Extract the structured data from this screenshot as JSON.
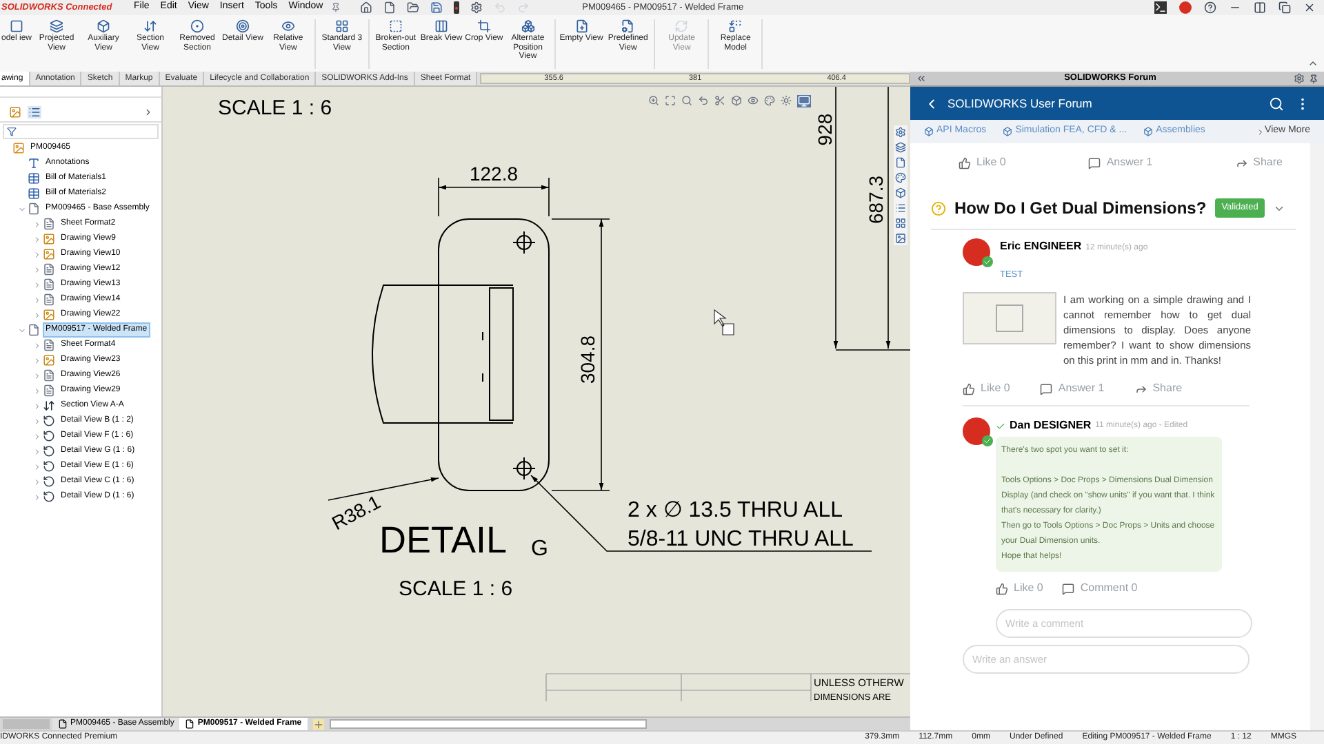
{
  "title_bar": {
    "brand": "SOLIDWORKS Connected",
    "menus": [
      "File",
      "Edit",
      "View",
      "Insert",
      "Tools",
      "Window"
    ],
    "title": "PM009465 - PM009517 - Welded Frame"
  },
  "ribbon": {
    "groups": [
      [
        {
          "label": "odel iew",
          "disabled": false
        },
        {
          "label": "Projected View",
          "disabled": false
        },
        {
          "label": "Auxiliary View",
          "disabled": false
        },
        {
          "label": "Section View",
          "disabled": false
        },
        {
          "label": "Removed Section",
          "disabled": false
        },
        {
          "label": "Detail View",
          "disabled": false
        },
        {
          "label": "Relative View",
          "disabled": false
        }
      ],
      [
        {
          "label": "Standard 3 View",
          "disabled": false
        }
      ],
      [
        {
          "label": "Broken-out Section",
          "disabled": false
        },
        {
          "label": "Break View",
          "disabled": false
        },
        {
          "label": "Crop View",
          "disabled": false
        },
        {
          "label": "Alternate Position View",
          "disabled": false
        }
      ],
      [
        {
          "label": "Empty View",
          "disabled": false
        },
        {
          "label": "Predefined View",
          "disabled": false
        }
      ],
      [
        {
          "label": "Update View",
          "disabled": true
        }
      ],
      [
        {
          "label": "Replace Model",
          "disabled": false
        }
      ]
    ]
  },
  "tabs": [
    {
      "label": "awing",
      "selected": true
    },
    {
      "label": "Annotation",
      "selected": false
    },
    {
      "label": "Sketch",
      "selected": false
    },
    {
      "label": "Markup",
      "selected": false
    },
    {
      "label": "Evaluate",
      "selected": false
    },
    {
      "label": "Lifecycle and Collaboration",
      "selected": false
    },
    {
      "label": "SOLIDWORKS Add-Ins",
      "selected": false
    },
    {
      "label": "Sheet Format",
      "selected": false
    }
  ],
  "ruler": [
    "355.6",
    "381",
    "406.4"
  ],
  "tree": [
    {
      "label": "PM009465",
      "kind": "drawing",
      "selected": false,
      "children": [
        {
          "label": "Annotations",
          "kind": "annotations",
          "selected": false
        },
        {
          "label": "Bill of Materials1",
          "kind": "bom",
          "selected": false
        },
        {
          "label": "Bill of Materials2",
          "kind": "bom",
          "selected": false
        },
        {
          "label": "PM009465 - Base Assembly",
          "kind": "sheet",
          "selected": false,
          "expanded": true,
          "children": [
            {
              "label": "Sheet Format2",
              "kind": "sheet-format",
              "selected": false,
              "expanded": false
            },
            {
              "label": "Drawing View9",
              "kind": "model-view",
              "selected": false,
              "expanded": false
            },
            {
              "label": "Drawing View10",
              "kind": "model-view",
              "selected": false,
              "expanded": false
            },
            {
              "label": "Drawing View12",
              "kind": "view",
              "selected": false,
              "expanded": false
            },
            {
              "label": "Drawing View13",
              "kind": "view",
              "selected": false,
              "expanded": false
            },
            {
              "label": "Drawing View14",
              "kind": "view",
              "selected": false,
              "expanded": false
            },
            {
              "label": "Drawing View22",
              "kind": "model-view",
              "selected": false,
              "expanded": false
            }
          ]
        },
        {
          "label": "PM009517 - Welded Frame",
          "kind": "sheet",
          "selected": true,
          "expanded": true,
          "children": [
            {
              "label": "Sheet Format4",
              "kind": "sheet-format",
              "selected": false,
              "expanded": false
            },
            {
              "label": "Drawing View23",
              "kind": "model-view",
              "selected": false,
              "expanded": false
            },
            {
              "label": "Drawing View26",
              "kind": "view",
              "selected": false,
              "expanded": false
            },
            {
              "label": "Drawing View29",
              "kind": "view",
              "selected": false,
              "expanded": false
            },
            {
              "label": "Section View A-A",
              "kind": "section",
              "selected": false,
              "expanded": false
            },
            {
              "label": "Detail View B (1 : 2)",
              "kind": "detail",
              "selected": false,
              "expanded": false
            },
            {
              "label": "Detail View F (1 : 6)",
              "kind": "detail",
              "selected": false,
              "expanded": false
            },
            {
              "label": "Detail View G (1 : 6)",
              "kind": "detail",
              "selected": false,
              "expanded": false
            },
            {
              "label": "Detail View E (1 : 6)",
              "kind": "detail",
              "selected": false,
              "expanded": false
            },
            {
              "label": "Detail View C (1 : 6)",
              "kind": "detail",
              "selected": false,
              "expanded": false
            },
            {
              "label": "Detail View D (1 : 6)",
              "kind": "detail",
              "selected": false,
              "expanded": false
            }
          ]
        }
      ]
    }
  ],
  "drawing": {
    "scale_top": "SCALE 1 : 6",
    "width_dim": "122.8",
    "height_dim": "304.8",
    "radius_dim": "R38.1",
    "side_dims": [
      "928",
      "687.3"
    ],
    "detail_label": "DETAIL",
    "detail_letter": "G",
    "detail_scale": "SCALE 1 : 6",
    "notes": [
      "2 x ∅ 13.5 THRU ALL",
      "5/8-11 UNC THRU ALL"
    ],
    "title_block": [
      "UNLESS OTHERW",
      "DIMENSIONS ARE"
    ]
  },
  "sheet_tabs": [
    {
      "label": "PM009465 - Base Assembly",
      "selected": false
    },
    {
      "label": "PM009517 - Welded Frame",
      "selected": true
    }
  ],
  "forum": {
    "panel_title": "SOLIDWORKS Forum",
    "nav_title": "SOLIDWORKS User Forum",
    "categories": [
      "API Macros",
      "Simulation FEA, CFD & ...",
      "Assemblies"
    ],
    "view_more": "View More",
    "top_actions": [
      {
        "kind": "like",
        "label": "Like",
        "count": "0"
      },
      {
        "kind": "answer",
        "label": "Answer",
        "count": "1"
      },
      {
        "kind": "share",
        "label": "Share"
      }
    ],
    "question": {
      "title": "How Do I Get Dual Dimensions?",
      "badge": "Validated",
      "author": "Eric ENGINEER",
      "time": "12 minute(s) ago",
      "verified": true,
      "tag": "TEST",
      "body": "I am working on a simple drawing and I cannot remember how to get dual dimensions to display. Does anyone remember? I want to show dimensions on this print in mm and in. Thanks!",
      "actions": [
        {
          "kind": "like",
          "label": "Like",
          "count": "0"
        },
        {
          "kind": "answer",
          "label": "Answer",
          "count": "1"
        },
        {
          "kind": "share",
          "label": "Share"
        }
      ]
    },
    "answer": {
      "author": "Dan DESIGNER",
      "time": "11 minute(s) ago - Edited",
      "accepted": true,
      "verified": true,
      "paragraphs": [
        "There's two spot you want to set it:",
        "Tools Options > Doc Props > Dimensions Dual Dimension Display (and check on \"show units\" if you want that. I think that's necessary for clarity.)\nThen go to Tools Options > Doc Props > Units and choose your Dual Dimension units.\nHope that helps!"
      ],
      "actions": [
        {
          "kind": "like",
          "label": "Like",
          "count": "0"
        },
        {
          "kind": "comment",
          "label": "Comment",
          "count": "0"
        }
      ],
      "comment_placeholder": "Write a comment"
    },
    "answer_placeholder": "Write an answer"
  },
  "status_bar": {
    "product": "IDWORKS Connected Premium",
    "fields": [
      "379.3mm",
      "112.7mm",
      "0mm",
      "Under Defined",
      "Editing PM009517 - Welded Frame",
      "1 : 12",
      "MMGS"
    ]
  }
}
